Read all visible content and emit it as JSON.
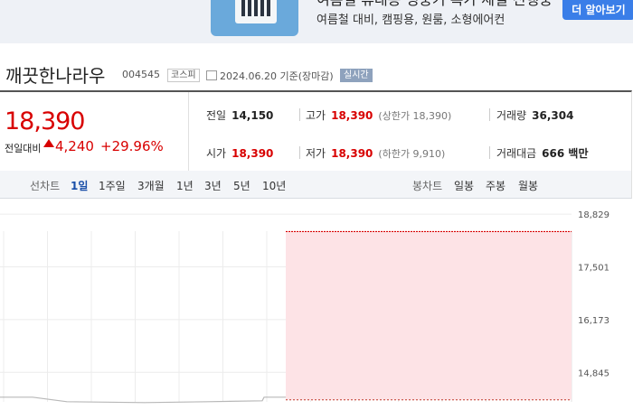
{
  "ad": {
    "title": "여름철 휴대용 냉풍기 특가 세일 진행중",
    "subtitle": "여름철 대비, 캠핑용, 원룸, 소형에어컨",
    "button_label": "더 알아보기"
  },
  "stock": {
    "name": "깨끗한나라우",
    "code": "004545",
    "market": "코스피",
    "date_text": "2024.06.20 기준(장마감)",
    "live_label": "실시간"
  },
  "price": {
    "now": "18,390",
    "diff_label": "전일대비",
    "diff_value": "4,240",
    "diff_rate": "+29.96%",
    "direction": "up"
  },
  "stats": {
    "prev_close_label": "전일",
    "prev_close": "14,150",
    "high_label": "고가",
    "high": "18,390",
    "upper_limit_text": "(상한가 18,390)",
    "volume_label": "거래량",
    "volume": "36,304",
    "open_label": "시가",
    "open": "18,390",
    "low_label": "저가",
    "low": "18,390",
    "lower_limit_text": "(하한가 9,910)",
    "amount_label": "거래대금",
    "amount": "666 백만"
  },
  "chart_tabs": {
    "line_label": "선차트",
    "line_items": [
      "1일",
      "1주일",
      "3개월",
      "1년",
      "3년",
      "5년",
      "10년"
    ],
    "active": "1일",
    "candle_label": "봉차트",
    "candle_items": [
      "일봉",
      "주봉",
      "월봉"
    ]
  },
  "colors": {
    "up": "#d80000",
    "accent": "#1a4fa8",
    "fill": "#fde3e6"
  },
  "chart_data": {
    "type": "area",
    "y_ticks": [
      "18,829",
      "17,501",
      "16,173",
      "14,845"
    ],
    "y_tick_values": [
      18829,
      17501,
      16173,
      14845
    ],
    "ylim": [
      14100,
      18900
    ],
    "prev_close": 14150,
    "price_level": 18390,
    "grid": true
  }
}
